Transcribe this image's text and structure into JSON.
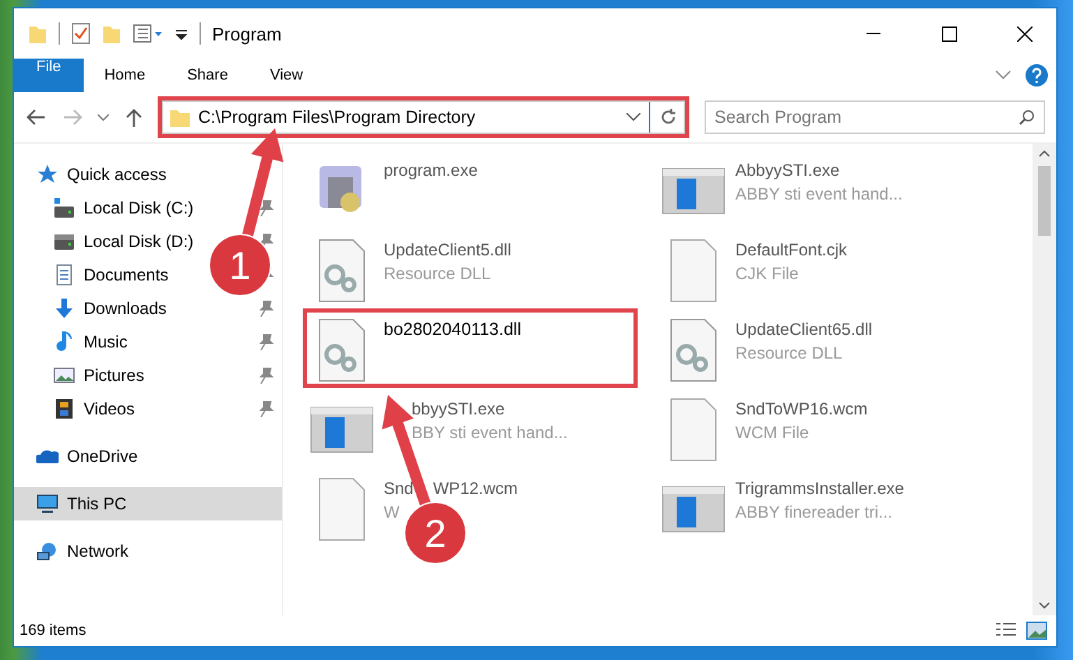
{
  "window": {
    "title": "Program"
  },
  "ribbon_tabs": [
    {
      "label": "File",
      "kind": "file"
    },
    {
      "label": "Home",
      "kind": "tab"
    },
    {
      "label": "Share",
      "kind": "tab"
    },
    {
      "label": "View",
      "kind": "tab"
    }
  ],
  "address_bar": {
    "path": "C:\\Program Files\\Program Directory",
    "outlined": true
  },
  "search": {
    "placeholder": "Search Program"
  },
  "nav": [
    {
      "label": "Quick access",
      "kind": "star",
      "selected": false,
      "pinned": false,
      "children": [
        {
          "label": "Local Disk (C:)",
          "kind": "drive-c",
          "selected": false,
          "pinned": true
        },
        {
          "label": "Local Disk (D:)",
          "kind": "drive",
          "selected": false,
          "pinned": true
        },
        {
          "label": "Documents",
          "kind": "document",
          "selected": false,
          "pinned": true
        },
        {
          "label": "Downloads",
          "kind": "download",
          "selected": false,
          "pinned": true
        },
        {
          "label": "Music",
          "kind": "music",
          "selected": false,
          "pinned": true
        },
        {
          "label": "Pictures",
          "kind": "pictures",
          "selected": false,
          "pinned": true
        },
        {
          "label": "Videos",
          "kind": "video",
          "selected": false,
          "pinned": true
        }
      ]
    },
    {
      "label": "OneDrive",
      "kind": "cloud",
      "selected": false,
      "pinned": false
    },
    {
      "label": "This PC",
      "kind": "pc",
      "selected": true,
      "pinned": false
    },
    {
      "label": "Network",
      "kind": "network",
      "selected": false,
      "pinned": false
    }
  ],
  "files": [
    {
      "name": "program.exe",
      "kind": "app",
      "outlined": false
    },
    {
      "name": "AbbyySTI.exe",
      "description": "ABBY sti event hand...",
      "kind": "window",
      "outlined": false
    },
    {
      "name": "UpdateClient5.dll",
      "description": "Resource DLL",
      "kind": "dll",
      "outlined": false
    },
    {
      "name": "DefaultFont.cjk",
      "description": "CJK File",
      "kind": "blank",
      "outlined": false
    },
    {
      "name": "bo2802040113.dll",
      "kind": "dll",
      "outlined": true
    },
    {
      "name": "UpdateClient65.dll",
      "description": "Resource DLL",
      "kind": "dll",
      "outlined": false
    },
    {
      "name": "bbyySTI.exe",
      "description": "BBY sti event hand...",
      "kind": "window",
      "outlined": false,
      "partly_covered": true
    },
    {
      "name": "SndToWP16.wcm",
      "description": "WCM File",
      "kind": "blank",
      "outlined": false
    },
    {
      "name": "Snd",
      "name_rest": "WP12.wcm",
      "description": "W",
      "kind": "blank",
      "outlined": false
    },
    {
      "name": "TrigrammsInstaller.exe",
      "description": "ABBY finereader tri...",
      "kind": "window",
      "outlined": false
    }
  ],
  "callouts": [
    {
      "number": "1"
    },
    {
      "number": "2"
    }
  ],
  "status_bar": {
    "item_count": "169 items"
  }
}
